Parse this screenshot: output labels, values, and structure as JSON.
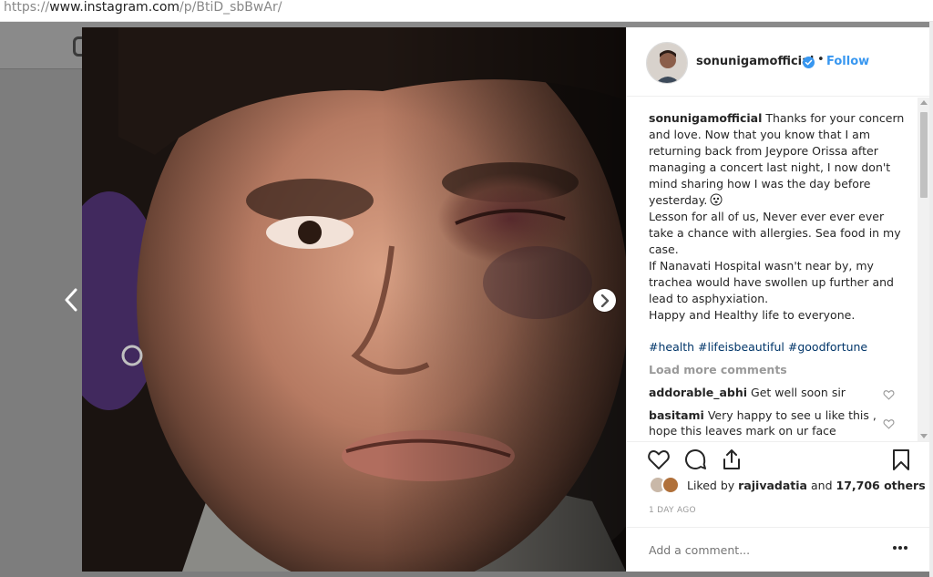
{
  "browser": {
    "url_scheme": "https://",
    "url_host": "www.instagram.com",
    "url_path": "/p/BtiD_sbBwAr/"
  },
  "post": {
    "username": "sonunigamofficial",
    "bullet": "•",
    "follow_label": "Follow",
    "caption_username": "sonunigamofficial",
    "caption_lines": [
      "Thanks for your concern",
      "and love. Now that you know that I am",
      "returning back from Jeypore Orissa after",
      "managing a concert last night, I now don't",
      "mind sharing how I was the day before",
      "yesterday.",
      "Lesson for all of us, Never ever ever ever",
      "take a chance with allergies. Sea food in my",
      "case.",
      "If Nanavati Hospital wasn't near by, my",
      "trachea would have swollen up further and",
      "lead to asphyxiation.",
      "Happy and Healthy life to everyone."
    ],
    "hashtags": "#health #lifeisbeautiful #goodfortune",
    "load_more": "Load more comments",
    "comments": [
      {
        "user": "addorable_abhi",
        "lines": [
          "Get well soon sir"
        ]
      },
      {
        "user": "basitami",
        "lines": [
          "Very happy to see u like this ,",
          "hope this leaves mark on ur face"
        ]
      }
    ],
    "likes_prefix": "Liked by",
    "likes_user": "rajivadatia",
    "likes_and": "and",
    "likes_count": "17,706 others",
    "timestamp": "1 DAY AGO",
    "add_comment_placeholder": "Add a comment..."
  },
  "colors": {
    "link_blue": "#3897f0",
    "hashtag_blue": "#003569",
    "muted_gray": "#999999",
    "text_dark": "#262626"
  },
  "icons": [
    "instagram-logo-icon",
    "chevron-left-icon",
    "chevron-right-icon",
    "verified-badge-icon",
    "heart-icon",
    "comment-icon",
    "share-icon",
    "bookmark-icon",
    "more-options-icon",
    "emoji-face-icon"
  ]
}
